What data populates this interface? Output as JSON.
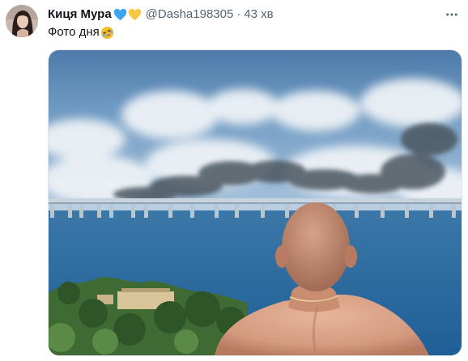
{
  "tweet": {
    "author_name": "Киця Мура",
    "author_handle": "@Dasha198305",
    "separator": "·",
    "time_ago": "43 хв",
    "text": "Фото дня",
    "emoji_icon": "rolling-on-floor-laughing-emoji",
    "name_badges": [
      "blue-heart-icon",
      "yellow-heart-icon"
    ],
    "colors": {
      "blue_heart": "#3aa8f0",
      "yellow_heart": "#f7c842",
      "muted_text": "#536471"
    }
  }
}
